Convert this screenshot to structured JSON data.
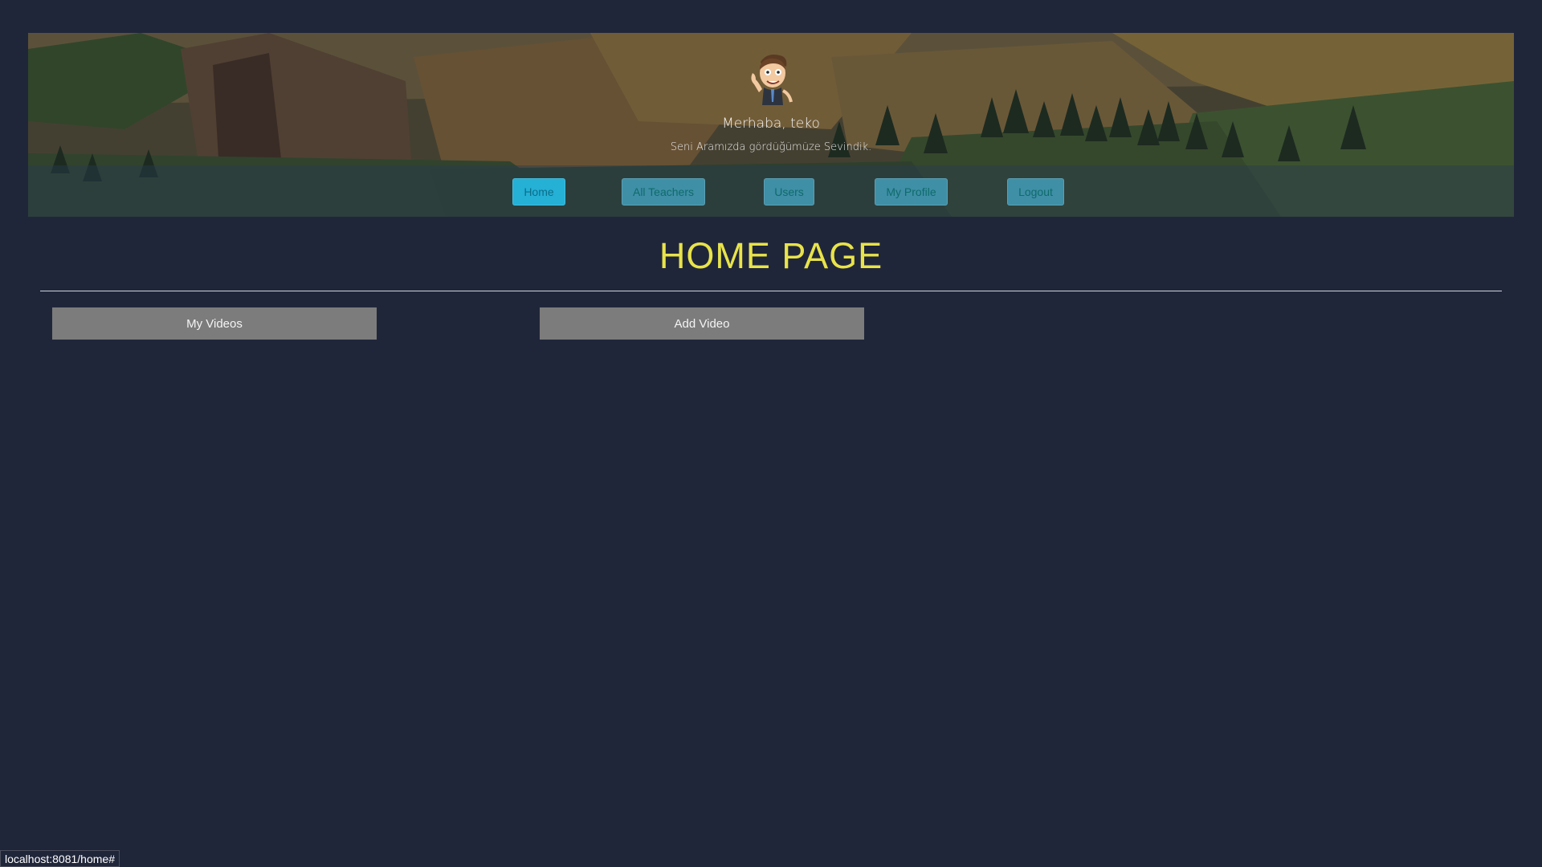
{
  "header": {
    "greeting": "Merhaba, teko",
    "subtitle": "Seni Aramızda gördüğümüze Sevindik."
  },
  "nav": {
    "items": [
      {
        "label": "Home",
        "active": true
      },
      {
        "label": "All Teachers",
        "active": false
      },
      {
        "label": "Users",
        "active": false
      },
      {
        "label": "My Profile",
        "active": false
      },
      {
        "label": "Logout",
        "active": false
      }
    ]
  },
  "main": {
    "title": "HOME PAGE",
    "buttons": {
      "my_videos": "My Videos",
      "add_video": "Add Video"
    }
  },
  "status_bar": {
    "url": "localhost:8081/home#"
  },
  "colors": {
    "page_background": "#20263a",
    "title": "#e8e34a",
    "nav_button": "#3f8fa6",
    "nav_button_active": "#25b0d6",
    "action_button": "#7c7c7c"
  },
  "icons": {
    "avatar": "cartoon-man-avatar-icon"
  }
}
